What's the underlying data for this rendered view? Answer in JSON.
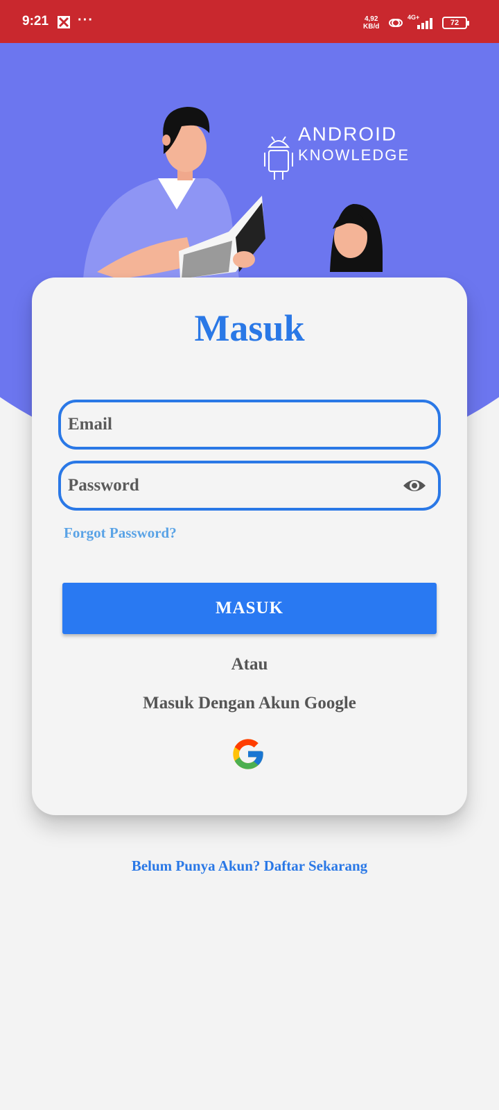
{
  "status_bar": {
    "time": "9:21",
    "more": "···",
    "speed_value": "4,92",
    "speed_unit": "KB/d",
    "network": "4G+",
    "battery": "72"
  },
  "branding": {
    "logo_line1": "ANDROID",
    "logo_line2": "KNOWLEDGE"
  },
  "login": {
    "title": "Masuk",
    "email_placeholder": "Email",
    "password_placeholder": "Password",
    "forgot_password": "Forgot Password?",
    "submit_label": "MASUK",
    "or_text": "Atau",
    "google_text": "Masuk Dengan Akun Google"
  },
  "footer": {
    "register_text": "Belum Punya Akun? Daftar Sekarang"
  },
  "colors": {
    "status_bar": "#c9282e",
    "hero": "#6c76ef",
    "accent": "#2a78e6",
    "button": "#2979f2",
    "link_light": "#5aa3e6"
  }
}
